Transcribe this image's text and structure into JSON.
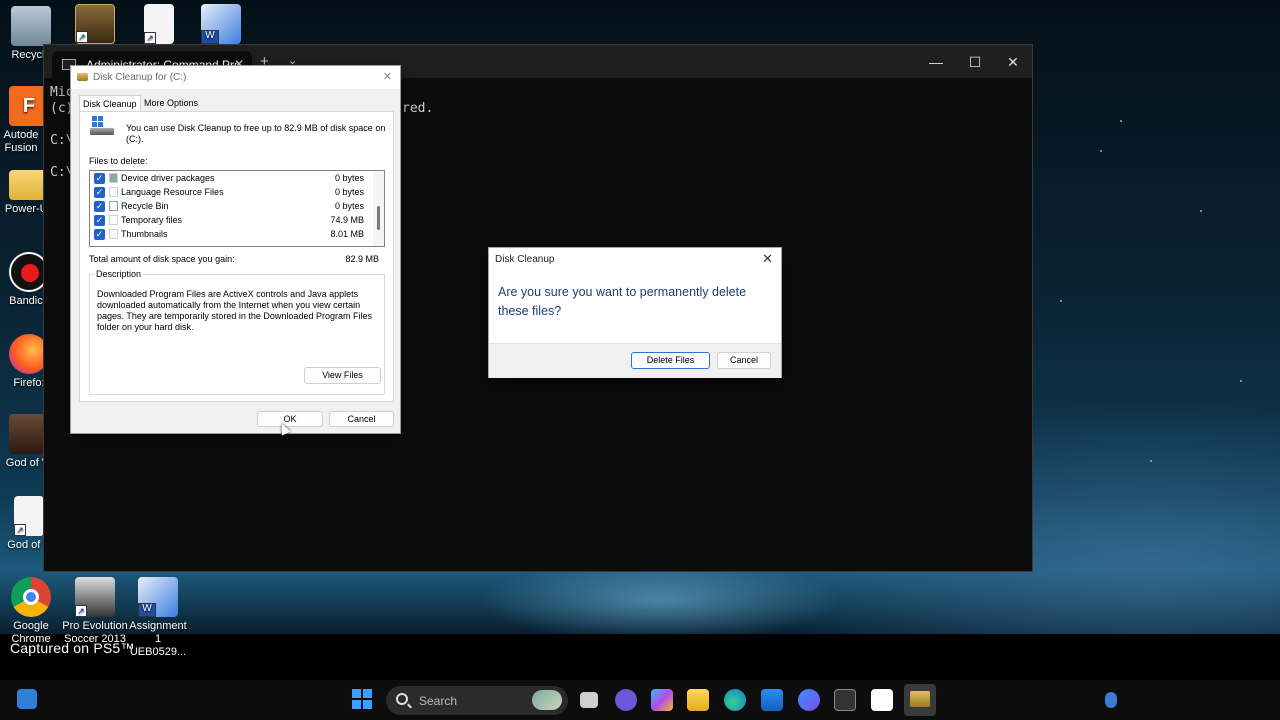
{
  "overlay": {
    "captured_text": "Captured on PS5™"
  },
  "desktop": {
    "icons": [
      {
        "label": "Recycle"
      },
      {
        "label": "Autode Fusion"
      },
      {
        "label": "Power-Us"
      },
      {
        "label": "Bandica"
      },
      {
        "label": "Firefo:"
      },
      {
        "label": "God of W"
      },
      {
        "label": "God of V"
      },
      {
        "label": "Google Chrome"
      },
      {
        "label": "Pro Evolution Soccer 2013"
      },
      {
        "label": "Assignment 1 UEB0529..."
      }
    ]
  },
  "cmd_window": {
    "tab_title": "Administrator: Command Pro",
    "lines": [
      "Mic",
      "(c)",
      "",
      "C:\\",
      "",
      "C:\\"
    ],
    "fragment": "red."
  },
  "disk_cleanup": {
    "title": "Disk Cleanup for  (C:)",
    "tabs": [
      "Disk Cleanup",
      "More Options"
    ],
    "intro": "You can use Disk Cleanup to free up to 82.9 MB of disk space on (C:).",
    "files_to_delete_label": "Files to delete:",
    "files": [
      {
        "name": "Device driver packages",
        "size": "0 bytes",
        "checked": true
      },
      {
        "name": "Language Resource Files",
        "size": "0 bytes",
        "checked": true
      },
      {
        "name": "Recycle Bin",
        "size": "0 bytes",
        "checked": true
      },
      {
        "name": "Temporary files",
        "size": "74.9 MB",
        "checked": true
      },
      {
        "name": "Thumbnails",
        "size": "8.01 MB",
        "checked": true
      }
    ],
    "total_label": "Total amount of disk space you gain:",
    "total_value": "82.9 MB",
    "description_label": "Description",
    "description_text": "Downloaded Program Files are ActiveX controls and Java applets downloaded automatically from the Internet when you view certain pages. They are temporarily stored in the Downloaded Program Files folder on your hard disk.",
    "view_files_label": "View Files",
    "ok_label": "OK",
    "cancel_label": "Cancel"
  },
  "confirm_dialog": {
    "title": "Disk Cleanup",
    "message": "Are you sure you want to permanently delete these files?",
    "delete_label": "Delete Files",
    "cancel_label": "Cancel"
  },
  "taskbar": {
    "search_placeholder": "Search"
  },
  "colors": {
    "accent": "#1f62c8",
    "confirm_text": "#1a3e7a",
    "taskbar": "#0d0d0d"
  }
}
